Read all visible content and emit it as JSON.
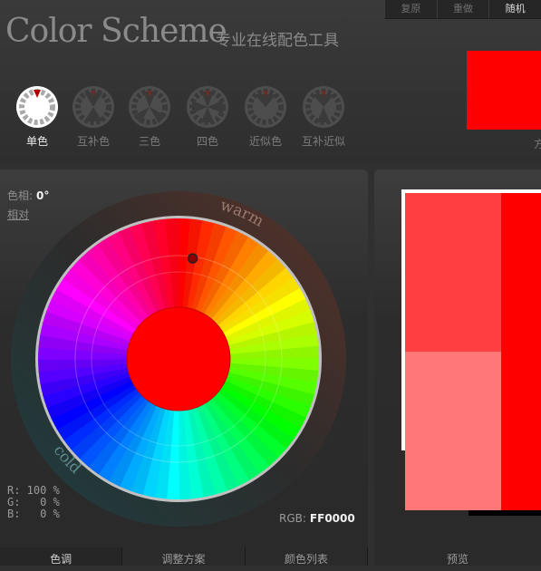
{
  "app": {
    "logo": "Color Scheme",
    "tagline": "专业在线配色工具"
  },
  "toolbar": {
    "items": [
      {
        "label": "复原",
        "enabled": false
      },
      {
        "label": "重做",
        "enabled": false
      },
      {
        "label": "随机",
        "enabled": true
      }
    ]
  },
  "preview_top": {
    "color": "#FF0000",
    "caption": "方"
  },
  "modes": [
    {
      "label": "单色",
      "icon": "mono-scheme-icon",
      "active": true
    },
    {
      "label": "互补色",
      "icon": "complement-scheme-icon",
      "active": false
    },
    {
      "label": "三色",
      "icon": "triad-scheme-icon",
      "active": false
    },
    {
      "label": "四色",
      "icon": "tetrad-scheme-icon",
      "active": false
    },
    {
      "label": "近似色",
      "icon": "analogic-scheme-icon",
      "active": false
    },
    {
      "label": "互补近似",
      "icon": "accented-analogic-scheme-icon",
      "active": false
    }
  ],
  "wheel": {
    "hue_label": "色相:",
    "hue_value": "0°",
    "relative_link": "相对",
    "warm_label": "warm",
    "cold_label": "cold",
    "center_color": "#FF0000",
    "selected_hue_deg": 0
  },
  "rgb": {
    "r_line": "R: 100 %",
    "g_line": "G:   0 %",
    "b_line": "B:   0 %",
    "hex_label": "RGB:",
    "hex_value": "FF0000"
  },
  "swatches": {
    "colors": [
      "#FF3F3F",
      "#FF7777",
      "#FF0000"
    ]
  },
  "tabs": {
    "left": [
      {
        "label": "色调",
        "active": true
      },
      {
        "label": "调整方案",
        "active": false
      },
      {
        "label": "颜色列表",
        "active": false
      }
    ],
    "right": "预览"
  }
}
